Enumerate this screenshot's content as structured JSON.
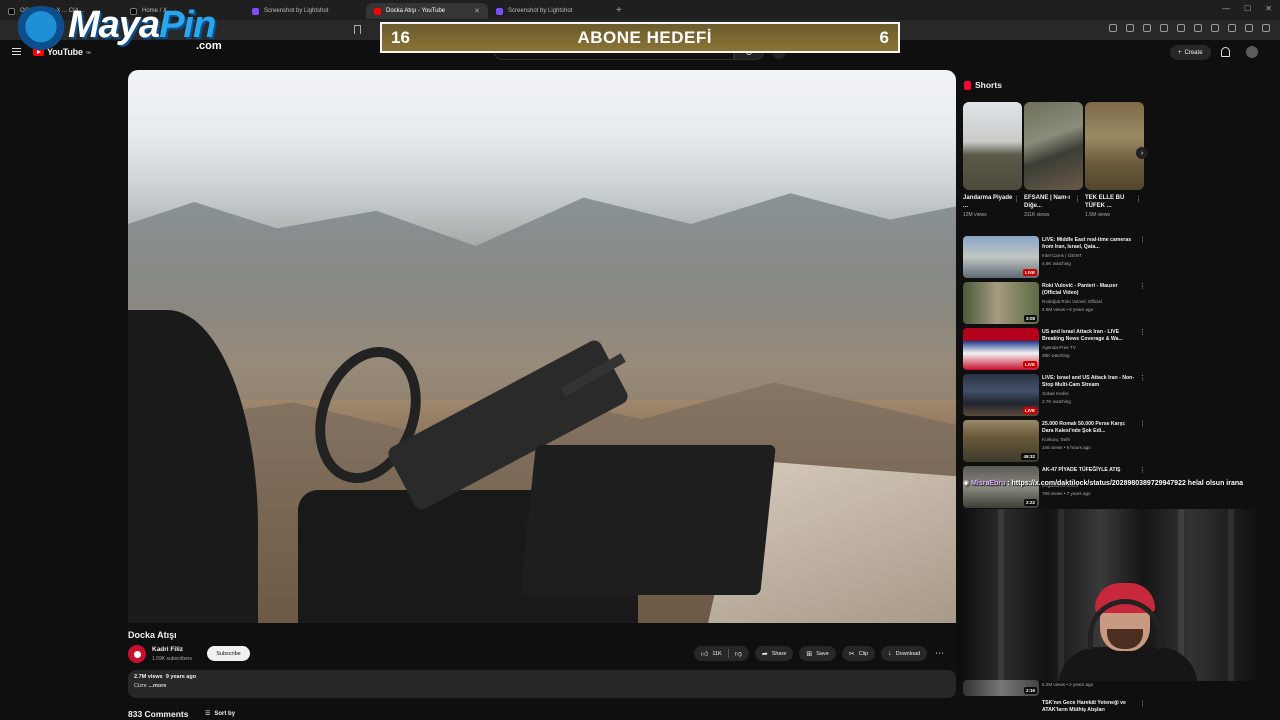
{
  "browser": {
    "tabs": [
      {
        "label": "OG...ader on X ... CIA ...",
        "icon": "x-logo",
        "active": false
      },
      {
        "label": "Home / X",
        "icon": "x-logo",
        "active": false
      },
      {
        "label": "Screenshot by Lightshot",
        "icon": "lightshot-icon",
        "active": false
      },
      {
        "label": "Docka Atışı - YouTube",
        "icon": "youtube-icon",
        "active": true
      },
      {
        "label": "Screenshot by Lightshot",
        "icon": "lightshot-icon",
        "active": false
      }
    ],
    "new_tab": "+"
  },
  "youtube": {
    "logo_text": "YouTube",
    "logo_region": "TR",
    "create_label": "Create"
  },
  "overlay": {
    "logo_main": "Maya",
    "logo_accent": "Pin",
    "logo_domain": ".com",
    "goal": {
      "current": "16",
      "title": "ABONE HEDEFİ",
      "target": "6"
    },
    "chat": {
      "user": "MisraEbru",
      "message": "https://x.com/daktilock/status/2028980389729947922 helal olsun irana"
    }
  },
  "video": {
    "title": "Docka Atışı",
    "channel_name": "Kadri Filiz",
    "channel_subs": "1.59K subscribers",
    "subscribe_label": "Subscribe",
    "likes": "11K",
    "share_label": "Share",
    "save_label": "Save",
    "clip_label": "Clip",
    "download_label": "Download",
    "views": "2.7M views",
    "age": "9 years ago",
    "description": "Cizre",
    "more_label": "...more",
    "comments_count": "833 Comments",
    "sort_label": "Sort by"
  },
  "sidebar": {
    "shorts_heading": "Shorts",
    "shorts": [
      {
        "title": "Jandarma Piyade ...",
        "views": "12M views"
      },
      {
        "title": "EFSANE | Nam-ı Diğe...",
        "views": "311K views"
      },
      {
        "title": "TEK ELLE BU TÜFEK ...",
        "views": "1.5M views"
      }
    ],
    "recommendations": [
      {
        "title": "LIVE: Middle East real-time cameras from Iran, Israel, Qata...",
        "channel": "Intel Cams | OSINT",
        "views": "4.6K watching",
        "badge": "LIVE"
      },
      {
        "title": "Roki Vulović - Panteri - Mauzer (Official Video)",
        "channel": "Rodoljub Roki Vulović Official",
        "views": "4.8M views • 6 years ago",
        "badge": "3:08"
      },
      {
        "title": "US and Israel Attack Iran - LIVE Breaking News Coverage & Wa...",
        "channel": "Agenda-Free TV",
        "views": "39K watching",
        "badge": "LIVE"
      },
      {
        "title": "LIVE: Israel and US Attack Iran - Non-Stop Multi-Cam Stream",
        "channel": "Sokak Kedisi",
        "views": "2.7K watching",
        "badge": "LIVE"
      },
      {
        "title": "25.000 Romalı 50.000 Perse Karşı: Dara Kalesi'nde Şok Edi...",
        "channel": "Korkunç Tarih",
        "views": "346 views • 6 hours ago",
        "badge": "49:32"
      },
      {
        "title": "AK-47 PİYADE TÜFEĞİYLE ATIŞ",
        "channel": "DoğadakiMotorcu",
        "views": "756 views • 7 years ago",
        "badge": "2:22"
      }
    ],
    "bottom_rec": {
      "views": "5.2M views • 2 years ago",
      "badge": "2:16",
      "title": "TSK'nın Gece Harekât Yeteneği ve ATAK'ların Müthiş Atışları"
    }
  },
  "colors": {
    "youtube_red": "#ff0000",
    "goal_bg": "#7a6630",
    "live_red": "#cc0000"
  }
}
